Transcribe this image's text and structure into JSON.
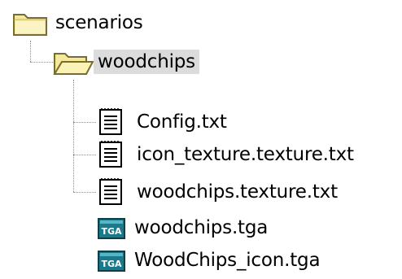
{
  "tree": {
    "root": {
      "label": "scenarios",
      "icon": "closed-folder-icon"
    },
    "child_folder": {
      "label": "woodchips",
      "icon": "open-folder-icon",
      "selected": true
    },
    "files": [
      {
        "label": "Config.txt",
        "icon": "text-file-icon"
      },
      {
        "label": "icon_texture.texture.txt",
        "icon": "text-file-icon"
      },
      {
        "label": "woodchips.texture.txt",
        "icon": "text-file-icon"
      },
      {
        "label": "woodchips.tga",
        "icon": "tga-file-icon"
      },
      {
        "label": "WoodChips_icon.tga",
        "icon": "tga-file-icon"
      }
    ],
    "colors": {
      "folder_yellow": "#f4e89a",
      "folder_outline": "#7a6b2e",
      "selection_bg": "#dcdcdc",
      "tga_badge": "#1a7a8c",
      "connector": "#8c8c8c"
    }
  }
}
